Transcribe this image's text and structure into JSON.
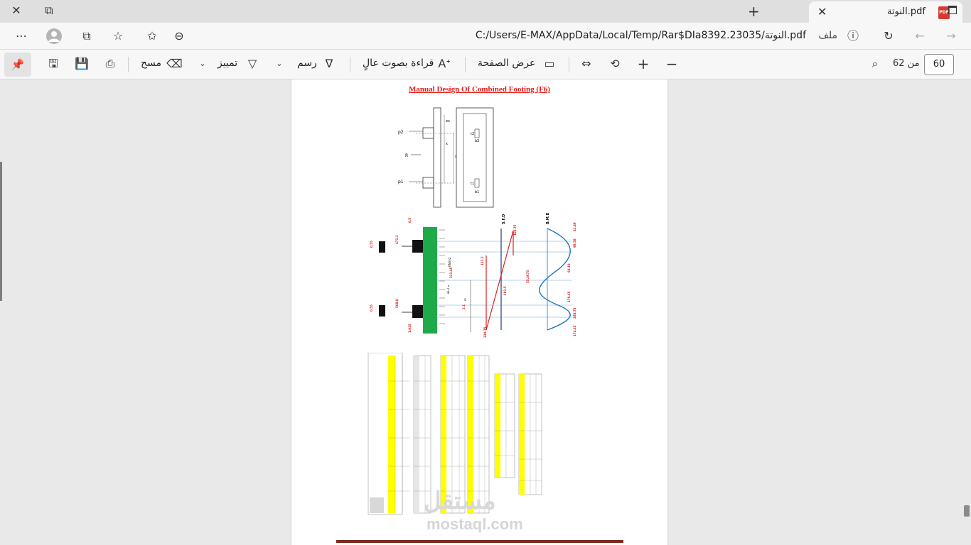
{
  "window": {
    "tab_title": "النوتة.pdf",
    "pdf_icon_label": "PDF",
    "close_tab": "✕",
    "new_tab": "+",
    "minimize": "✕",
    "restore": "⧉"
  },
  "address": {
    "url": "C:/Users/E-MAX/AppData/Local/Temp/Rar$DIa8392.23035/النوتة.pdf",
    "scheme_label": "ملف"
  },
  "toolbar": {
    "erase_label": "مسح",
    "highlight_label": "تمييز",
    "draw_label": "رسم",
    "read_aloud_label": "قراءة بصوت عالٍ",
    "page_view_label": "عرض الصفحة",
    "page_count": "من 62",
    "current_page": "60"
  },
  "document": {
    "title": "Manual Design Of Combined Footing (F6)",
    "sketch_labels": [
      "p2",
      "R",
      "p1",
      "ex",
      "x",
      "s",
      "t2",
      "b2",
      "t1",
      "b1"
    ],
    "column_labels": [
      "C2",
      "C1"
    ],
    "diagram_labels": [
      "S.F.D",
      "B.M.D",
      "KN/m2",
      "wu.l =",
      "m"
    ],
    "red_values": [
      "471.2",
      "0.5",
      "0.2",
      "0.5",
      "1.025",
      "0.5",
      "568.8",
      "0.2",
      "0.55",
      "331.45",
      "2.1",
      "122.2",
      "182.5",
      "339.75",
      "160.75",
      "55.3673",
      "98.58",
      "41.49",
      "179.65",
      "288.75",
      "174.15",
      "93.18"
    ],
    "watermark_main": "مستقل",
    "watermark_sub": "mostaql.com"
  },
  "colors": {
    "title_red": "#e41b17",
    "footing_green": "#1faa4a",
    "sfd_red": "#e02020",
    "bmd_blue": "#1b74c4",
    "table_yellow": "#ffff00"
  }
}
